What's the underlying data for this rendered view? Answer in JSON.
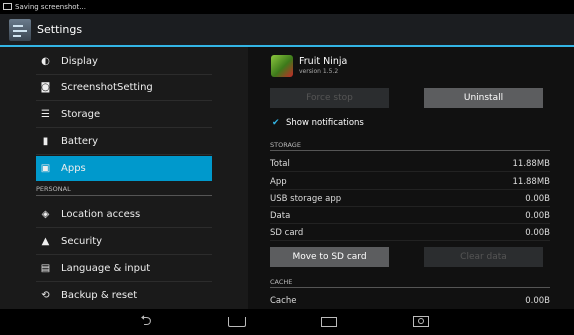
{
  "status_bar": {
    "notification": "Saving screenshot..."
  },
  "action_bar": {
    "title": "Settings"
  },
  "sidebar": {
    "items_top": [
      {
        "label": "Display",
        "icon": "brightness-icon"
      },
      {
        "label": "ScreenshotSetting",
        "icon": "camera-icon"
      },
      {
        "label": "Storage",
        "icon": "storage-icon"
      },
      {
        "label": "Battery",
        "icon": "battery-icon"
      },
      {
        "label": "Apps",
        "icon": "apps-icon",
        "selected": true
      }
    ],
    "section_personal": "PERSONAL",
    "items_personal": [
      {
        "label": "Location access",
        "icon": "location-icon"
      },
      {
        "label": "Security",
        "icon": "lock-icon"
      },
      {
        "label": "Language & input",
        "icon": "keyboard-icon"
      },
      {
        "label": "Backup & reset",
        "icon": "backup-icon"
      }
    ]
  },
  "app_info": {
    "name": "Fruit Ninja",
    "version": "version 1.5.2",
    "force_stop_label": "Force stop",
    "uninstall_label": "Uninstall",
    "show_notifications_label": "Show notifications",
    "show_notifications_checked": true,
    "storage_header": "STORAGE",
    "storage_rows": [
      {
        "label": "Total",
        "value": "11.88MB"
      },
      {
        "label": "App",
        "value": "11.88MB"
      },
      {
        "label": "USB storage app",
        "value": "0.00B"
      },
      {
        "label": "Data",
        "value": "0.00B"
      },
      {
        "label": "SD card",
        "value": "0.00B"
      }
    ],
    "move_to_sd_label": "Move to SD card",
    "clear_data_label": "Clear data",
    "cache_header": "CACHE",
    "cache_rows": [
      {
        "label": "Cache",
        "value": "0.00B"
      }
    ]
  },
  "navigation": {
    "buttons": [
      "back-icon",
      "home-icon",
      "recent-apps-icon",
      "screenshot-icon"
    ]
  },
  "colors": {
    "accent": "#33b5e5",
    "selected_bg": "#0099cc",
    "checkbox": "#33b5e5"
  }
}
